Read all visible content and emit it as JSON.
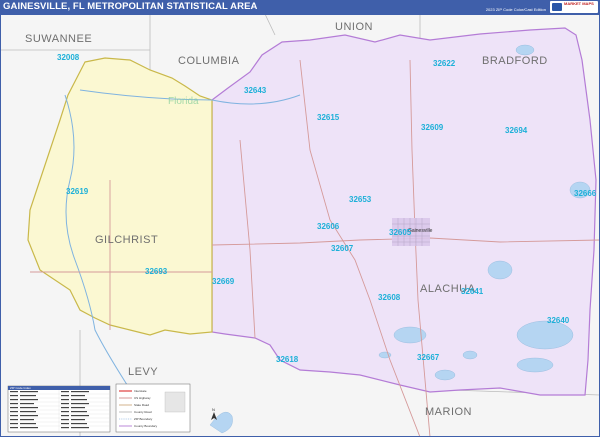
{
  "header": {
    "title": "GAINESVILLE, FL METROPOLITAN STATISTICAL AREA",
    "edition": "2023 ZIP Code Color/Cast Edition",
    "logo_text": "MARKET MAPS"
  },
  "counties": {
    "suwannee": "SUWANNEE",
    "columbia": "COLUMBIA",
    "union": "UNION",
    "bradford": "BRADFORD",
    "gilchrist": "GILCHRIST",
    "alachua": "ALACHUA",
    "levy": "LEVY",
    "marion": "MARION"
  },
  "state_label": "Florida",
  "city_label": "Gainesville",
  "zips": {
    "z32008": "32008",
    "z32622": "32622",
    "z32643": "32643",
    "z32615": "32615",
    "z32609": "32609",
    "z32694": "32694",
    "z32619": "32619",
    "z32653": "32653",
    "z32666": "32666",
    "z32606": "32606",
    "z32605": "32605",
    "z32607": "32607",
    "z32693": "32693",
    "z32669": "32669",
    "z32608": "32608",
    "z32641": "32641",
    "z32640": "32640",
    "z32618": "32618",
    "z32667": "32667"
  },
  "legend": {
    "title": "ZIP Code Index",
    "items": [
      "Interstate",
      "US Highway",
      "State Road",
      "County Road",
      "ZIP Boundary",
      "County Boundary"
    ]
  },
  "colors": {
    "header": "#3f5faa",
    "gilchrist_fill": "#fbf8d2",
    "alachua_fill": "#eee3f8",
    "water": "#b5d5f2",
    "zip_label": "#1db0d8",
    "outside": "#f5f5f5"
  },
  "icons": {
    "north_arrow": "compass-icon"
  }
}
